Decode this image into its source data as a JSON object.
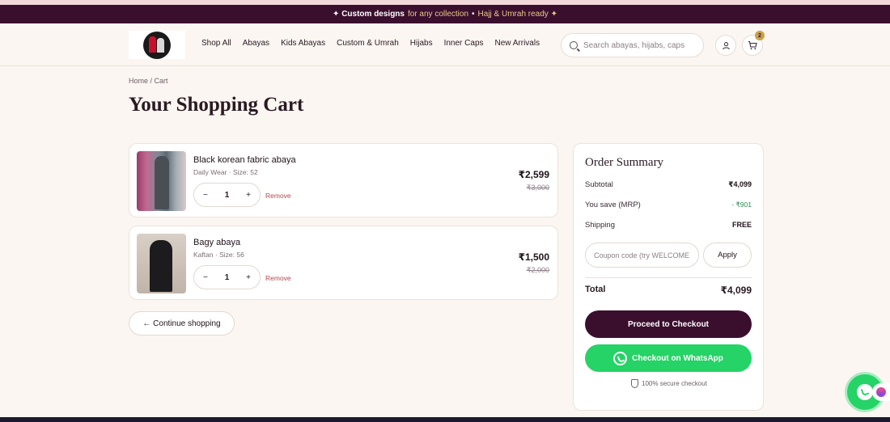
{
  "announcement": {
    "highlight": "✦ Custom designs",
    "text1": " for any collection ",
    "separator": "•",
    "text2": " Hajj & Umrah ready ✦"
  },
  "nav": {
    "items": [
      "Shop All",
      "Abayas",
      "Kids Abayas",
      "Custom & Umrah",
      "Hijabs",
      "Inner Caps",
      "New Arrivals"
    ]
  },
  "search": {
    "placeholder": "Search abayas, hijabs, caps"
  },
  "cart": {
    "count": "2"
  },
  "breadcrumb": "Home / Cart",
  "page_title": "Your Shopping Cart",
  "items": [
    {
      "name": "Black korean fabric abaya",
      "meta": "Daily Wear · Size: 52",
      "qty": "1",
      "price": "₹2,599",
      "mrp": "₹3,000",
      "remove": "Remove"
    },
    {
      "name": "Bagy abaya",
      "meta": "Kaftan · Size: 56",
      "qty": "1",
      "price": "₹1,500",
      "mrp": "₹2,000",
      "remove": "Remove"
    }
  ],
  "qty_minus": "−",
  "qty_plus": "+",
  "continue_label": "← Continue shopping",
  "summary": {
    "title": "Order Summary",
    "subtotal_label": "Subtotal",
    "subtotal": "₹4,099",
    "save_label": "You save (MRP)",
    "save": "- ₹901",
    "shipping_label": "Shipping",
    "shipping": "FREE",
    "coupon_placeholder": "Coupon code (try WELCOME",
    "apply_label": "Apply",
    "total_label": "Total",
    "total": "₹4,099",
    "checkout_label": "Proceed to Checkout",
    "whatsapp_label": "Checkout on WhatsApp",
    "secure_label": "100% secure checkout"
  },
  "colors": {
    "brand": "#3a0f2e",
    "accent_gold": "#e9c98a",
    "whatsapp": "#25d366",
    "background": "#fbf6f2"
  }
}
